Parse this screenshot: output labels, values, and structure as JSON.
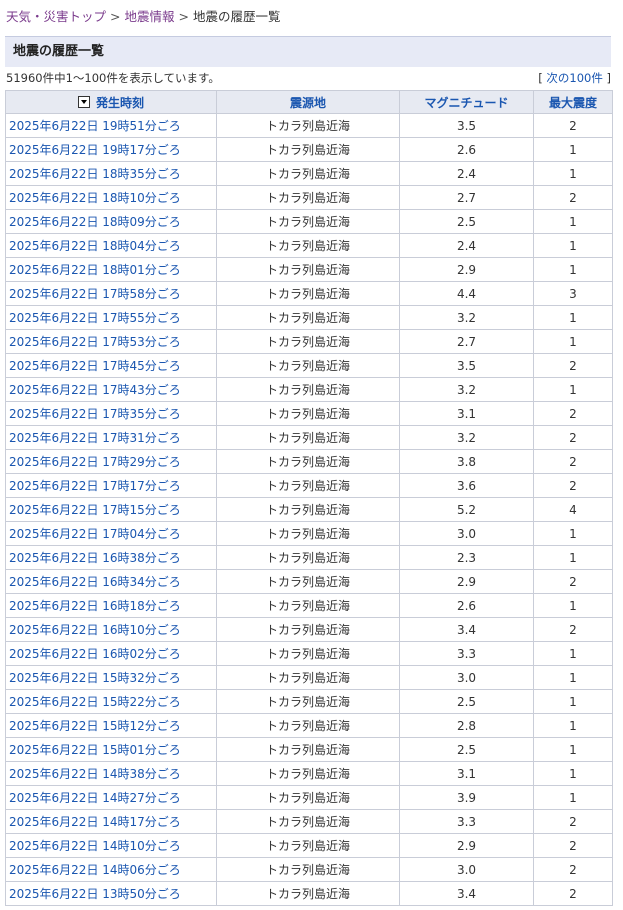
{
  "breadcrumb": {
    "items": [
      "天気・災害トップ",
      "地震情報"
    ],
    "separator": ">",
    "current": "地震の履歴一覧"
  },
  "heading": "地震の履歴一覧",
  "summary": "51960件中1～100件を表示しています。",
  "next_link": {
    "open": "[ ",
    "label": "次の100件",
    "close": " ]"
  },
  "table": {
    "headers": {
      "time": "発生時刻",
      "epicenter": "震源地",
      "magnitude": "マグニチュード",
      "intensity": "最大震度"
    },
    "sort_icon": "sort-down-icon",
    "rows": [
      {
        "time": "2025年6月22日 19時51分ごろ",
        "epicenter": "トカラ列島近海",
        "magnitude": "3.5",
        "intensity": "2"
      },
      {
        "time": "2025年6月22日 19時17分ごろ",
        "epicenter": "トカラ列島近海",
        "magnitude": "2.6",
        "intensity": "1"
      },
      {
        "time": "2025年6月22日 18時35分ごろ",
        "epicenter": "トカラ列島近海",
        "magnitude": "2.4",
        "intensity": "1"
      },
      {
        "time": "2025年6月22日 18時10分ごろ",
        "epicenter": "トカラ列島近海",
        "magnitude": "2.7",
        "intensity": "2"
      },
      {
        "time": "2025年6月22日 18時09分ごろ",
        "epicenter": "トカラ列島近海",
        "magnitude": "2.5",
        "intensity": "1"
      },
      {
        "time": "2025年6月22日 18時04分ごろ",
        "epicenter": "トカラ列島近海",
        "magnitude": "2.4",
        "intensity": "1"
      },
      {
        "time": "2025年6月22日 18時01分ごろ",
        "epicenter": "トカラ列島近海",
        "magnitude": "2.9",
        "intensity": "1"
      },
      {
        "time": "2025年6月22日 17時58分ごろ",
        "epicenter": "トカラ列島近海",
        "magnitude": "4.4",
        "intensity": "3"
      },
      {
        "time": "2025年6月22日 17時55分ごろ",
        "epicenter": "トカラ列島近海",
        "magnitude": "3.2",
        "intensity": "1"
      },
      {
        "time": "2025年6月22日 17時53分ごろ",
        "epicenter": "トカラ列島近海",
        "magnitude": "2.7",
        "intensity": "1"
      },
      {
        "time": "2025年6月22日 17時45分ごろ",
        "epicenter": "トカラ列島近海",
        "magnitude": "3.5",
        "intensity": "2"
      },
      {
        "time": "2025年6月22日 17時43分ごろ",
        "epicenter": "トカラ列島近海",
        "magnitude": "3.2",
        "intensity": "1"
      },
      {
        "time": "2025年6月22日 17時35分ごろ",
        "epicenter": "トカラ列島近海",
        "magnitude": "3.1",
        "intensity": "2"
      },
      {
        "time": "2025年6月22日 17時31分ごろ",
        "epicenter": "トカラ列島近海",
        "magnitude": "3.2",
        "intensity": "2"
      },
      {
        "time": "2025年6月22日 17時29分ごろ",
        "epicenter": "トカラ列島近海",
        "magnitude": "3.8",
        "intensity": "2"
      },
      {
        "time": "2025年6月22日 17時17分ごろ",
        "epicenter": "トカラ列島近海",
        "magnitude": "3.6",
        "intensity": "2"
      },
      {
        "time": "2025年6月22日 17時15分ごろ",
        "epicenter": "トカラ列島近海",
        "magnitude": "5.2",
        "intensity": "4"
      },
      {
        "time": "2025年6月22日 17時04分ごろ",
        "epicenter": "トカラ列島近海",
        "magnitude": "3.0",
        "intensity": "1"
      },
      {
        "time": "2025年6月22日 16時38分ごろ",
        "epicenter": "トカラ列島近海",
        "magnitude": "2.3",
        "intensity": "1"
      },
      {
        "time": "2025年6月22日 16時34分ごろ",
        "epicenter": "トカラ列島近海",
        "magnitude": "2.9",
        "intensity": "2"
      },
      {
        "time": "2025年6月22日 16時18分ごろ",
        "epicenter": "トカラ列島近海",
        "magnitude": "2.6",
        "intensity": "1"
      },
      {
        "time": "2025年6月22日 16時10分ごろ",
        "epicenter": "トカラ列島近海",
        "magnitude": "3.4",
        "intensity": "2"
      },
      {
        "time": "2025年6月22日 16時02分ごろ",
        "epicenter": "トカラ列島近海",
        "magnitude": "3.3",
        "intensity": "1"
      },
      {
        "time": "2025年6月22日 15時32分ごろ",
        "epicenter": "トカラ列島近海",
        "magnitude": "3.0",
        "intensity": "1"
      },
      {
        "time": "2025年6月22日 15時22分ごろ",
        "epicenter": "トカラ列島近海",
        "magnitude": "2.5",
        "intensity": "1"
      },
      {
        "time": "2025年6月22日 15時12分ごろ",
        "epicenter": "トカラ列島近海",
        "magnitude": "2.8",
        "intensity": "1"
      },
      {
        "time": "2025年6月22日 15時01分ごろ",
        "epicenter": "トカラ列島近海",
        "magnitude": "2.5",
        "intensity": "1"
      },
      {
        "time": "2025年6月22日 14時38分ごろ",
        "epicenter": "トカラ列島近海",
        "magnitude": "3.1",
        "intensity": "1"
      },
      {
        "time": "2025年6月22日 14時27分ごろ",
        "epicenter": "トカラ列島近海",
        "magnitude": "3.9",
        "intensity": "1"
      },
      {
        "time": "2025年6月22日 14時17分ごろ",
        "epicenter": "トカラ列島近海",
        "magnitude": "3.3",
        "intensity": "2"
      },
      {
        "time": "2025年6月22日 14時10分ごろ",
        "epicenter": "トカラ列島近海",
        "magnitude": "2.9",
        "intensity": "2"
      },
      {
        "time": "2025年6月22日 14時06分ごろ",
        "epicenter": "トカラ列島近海",
        "magnitude": "3.0",
        "intensity": "2"
      },
      {
        "time": "2025年6月22日 13時50分ごろ",
        "epicenter": "トカラ列島近海",
        "magnitude": "3.4",
        "intensity": "2"
      }
    ]
  }
}
